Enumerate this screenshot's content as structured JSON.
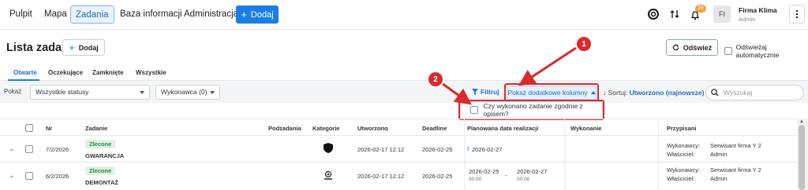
{
  "nav": {
    "items": [
      "Pulpit",
      "Mapa",
      "Zadania",
      "Baza informacji",
      "Administracja"
    ],
    "add_label": "Dodaj",
    "notification_count": "24",
    "user": {
      "initials": "FI",
      "name": "Firma Klima",
      "role": "Admin"
    }
  },
  "header": {
    "title": "Lista zadań",
    "add_label": "Dodaj",
    "refresh_label": "Odśwież",
    "auto_refresh_label": "Odświeżaj automatycznie"
  },
  "tabs": [
    "Otwarte",
    "Oczekujące",
    "Zamknięte",
    "Wszystkie"
  ],
  "filters": {
    "show_label": "Pokaż",
    "status_select": "Wszystkie statusy",
    "assignee_select": "Wykonawca (0)",
    "filter_label": "Filtruj",
    "show_columns_label": "Pokaż dodatkowe kolumny",
    "sort_label": "Sortuj:",
    "sort_value": "Utworzono (najnowsze)",
    "search_placeholder": "Wyszukaj"
  },
  "columns_popup": {
    "option_label": "Czy wykonano zadanie zgodnie z opisem?"
  },
  "markers": [
    "1",
    "2"
  ],
  "table": {
    "headers": [
      "Nr",
      "Zadanie",
      "Podzadania",
      "Kategorie",
      "Utworzono",
      "Deadline",
      "Planowana data realizacji",
      "Wykonanie",
      "Przypisani"
    ],
    "rows": [
      {
        "nr": "7/2/2026",
        "status": "Zlecone",
        "task": "GWARANCJA",
        "created": "2026-02-17 12:12",
        "deadline": "2026-02-25",
        "planned_start": "2026-02-27",
        "planned_start_time": "",
        "planned_end": "",
        "planned_end_time": "",
        "assignee_label": "Wykonawcy:",
        "assignee_value": "Serwisant firma Y 2",
        "owner_label": "Właściciel:",
        "owner_value": "Admin"
      },
      {
        "nr": "6/2/2026",
        "status": "Zlecone",
        "task": "DEMONTAŻ",
        "created": "2026-02-17 12:12",
        "deadline": "2026-02-25",
        "planned_start": "2026-02-25",
        "planned_start_time": "00:00",
        "planned_end": "2026-02-27",
        "planned_end_time": "00:00",
        "assignee_label": "Wykonawcy:",
        "assignee_value": "Serwisant firma Y 2",
        "owner_label": "Właściciel:",
        "owner_value": "Admin"
      }
    ]
  },
  "colors": {
    "accent": "#1a7ee6",
    "annotation": "#d92b2b",
    "status_green": "#2c8a3b"
  }
}
